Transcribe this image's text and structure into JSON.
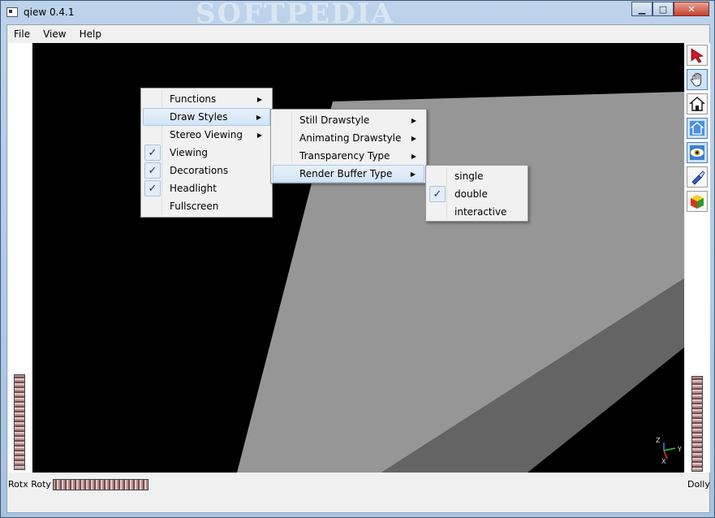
{
  "window": {
    "title": "qiew 0.4.1",
    "watermark": "SOFTPEDIA",
    "minimize": "▁",
    "maximize": "□",
    "close": "✕"
  },
  "menubar": {
    "file": "File",
    "view": "View",
    "help": "Help"
  },
  "context_menu": {
    "items": [
      {
        "label": "Functions",
        "submenu": true,
        "checked": false
      },
      {
        "label": "Draw Styles",
        "submenu": true,
        "checked": false
      },
      {
        "label": "Stereo Viewing",
        "submenu": true,
        "checked": false
      },
      {
        "label": "Viewing",
        "submenu": false,
        "checked": true
      },
      {
        "label": "Decorations",
        "submenu": false,
        "checked": true
      },
      {
        "label": "Headlight",
        "submenu": false,
        "checked": true
      },
      {
        "label": "Fullscreen",
        "submenu": false,
        "checked": false
      }
    ]
  },
  "draw_styles_menu": {
    "items": [
      {
        "label": "Still Drawstyle"
      },
      {
        "label": "Animating Drawstyle"
      },
      {
        "label": "Transparency Type"
      },
      {
        "label": "Render Buffer Type"
      }
    ]
  },
  "render_buffer_menu": {
    "items": [
      {
        "label": "single",
        "checked": false
      },
      {
        "label": "double",
        "checked": true
      },
      {
        "label": "interactive",
        "checked": false
      }
    ]
  },
  "status": {
    "left": "Rotx Roty",
    "right": "Dolly"
  },
  "axes": {
    "z": "Z",
    "y": "Y",
    "x": "X"
  },
  "check_mark": "✓",
  "submenu_arrow": "▶",
  "tools": [
    "select-arrow-icon",
    "hand-icon",
    "home-icon",
    "set-home-icon",
    "view-all-eye-icon",
    "seek-flashlight-icon",
    "projection-cube-icon"
  ],
  "colors": {
    "viewer_bg": "#000000",
    "plane_light": "#969696",
    "plane_dark": "#646464",
    "accent": "#17346e"
  }
}
